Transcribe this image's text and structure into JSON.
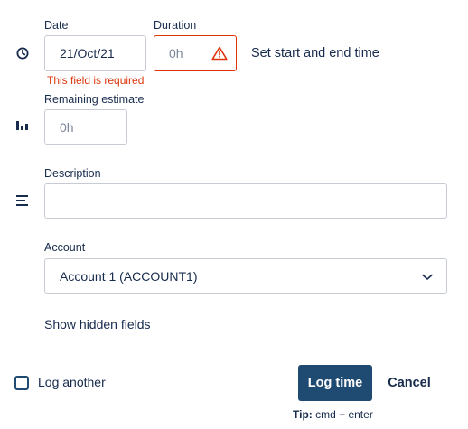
{
  "date": {
    "label": "Date",
    "value": "21/Oct/21"
  },
  "duration": {
    "label": "Duration",
    "placeholder": "0h",
    "error": "This field is required"
  },
  "set_time_link": "Set start and end time",
  "remaining": {
    "label": "Remaining estimate",
    "placeholder": "0h"
  },
  "description": {
    "label": "Description",
    "value": ""
  },
  "account": {
    "label": "Account",
    "selected": "Account 1 (ACCOUNT1)"
  },
  "show_hidden": "Show hidden fields",
  "log_another": {
    "label": "Log another",
    "checked": false
  },
  "buttons": {
    "log_time": "Log time",
    "cancel": "Cancel"
  },
  "tip": {
    "prefix": "Tip:",
    "text": " cmd + enter"
  },
  "colors": {
    "primary": "#1f4b72",
    "error": "#de350b",
    "text": "#172b4d",
    "border": "#c7ccd4"
  },
  "icons": [
    "clock-icon",
    "bar-chart-icon",
    "align-left-icon",
    "warning-icon",
    "chevron-down-icon"
  ]
}
